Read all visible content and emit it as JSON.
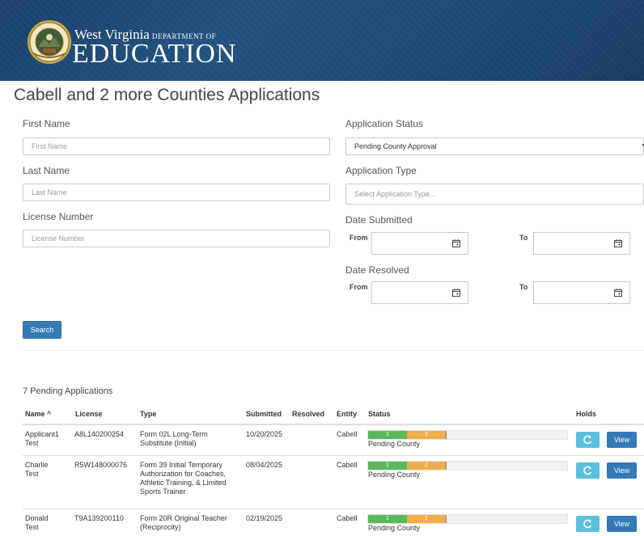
{
  "header": {
    "brand_line1": "West Virginia",
    "brand_small": "DEPARTMENT OF",
    "brand_line2": "EDUCATION",
    "seal_text": "STATE OF WEST VIRGINIA"
  },
  "page": {
    "title": "Cabell and 2 more Counties Applications"
  },
  "filters": {
    "first_name": {
      "label": "First Name",
      "placeholder": "First Name"
    },
    "last_name": {
      "label": "Last Name",
      "placeholder": "Last Name"
    },
    "license_number": {
      "label": "License Number",
      "placeholder": "License Number"
    },
    "application_status": {
      "label": "Application Status",
      "value": "Pending County Approval"
    },
    "application_type": {
      "label": "Application Type",
      "placeholder": "Select Application Type..."
    },
    "date_submitted": {
      "label": "Date Submitted",
      "from": "From",
      "to": "To"
    },
    "date_resolved": {
      "label": "Date Resolved",
      "from": "From",
      "to": "To"
    },
    "search_label": "Search"
  },
  "results": {
    "count_label": "7 Pending Applications",
    "columns": [
      "Name ^",
      "License",
      "Type",
      "Submitted",
      "Resolved",
      "Entity",
      "Status",
      "Holds"
    ],
    "rows": [
      {
        "name": [
          "Applicant1",
          "Test"
        ],
        "license": "A8L140200254",
        "type": [
          "Form 02L Long-Term",
          "Substitute (Initial)"
        ],
        "submitted": "10/20/2025",
        "resolved": "",
        "entity": "Cabell",
        "step1": "1",
        "step2": "2",
        "status": "Pending County",
        "view": "View"
      },
      {
        "name": [
          "Charlie",
          "Test"
        ],
        "license": "R5W148000076",
        "type": [
          "Form 39 Initial Temporary",
          "Authorization for Coaches,",
          "Athletic Training, & Limited",
          "Sports Trainer"
        ],
        "submitted": "08/04/2025",
        "resolved": "",
        "entity": "Cabell",
        "step1": "1",
        "step2": "2",
        "status": "Pending County",
        "view": "View"
      },
      {
        "name": [
          "Donald",
          "Test"
        ],
        "license": "T9A139200110",
        "type": [
          "Form 20R Original Teacher",
          "(Reciprocity)"
        ],
        "submitted": "02/19/2025",
        "resolved": "",
        "entity": "Cabell",
        "step1": "1",
        "step2": "2",
        "status": "Pending County",
        "view": "View"
      }
    ]
  },
  "icons": {
    "calendar": "calendar-icon",
    "refresh": "refresh-icon",
    "seal": "state-seal-icon"
  },
  "colors": {
    "banner": "#1f4a78",
    "primary": "#337ab7",
    "info": "#5bc0de",
    "success": "#5cb85c",
    "warning": "#f0ad4e"
  }
}
